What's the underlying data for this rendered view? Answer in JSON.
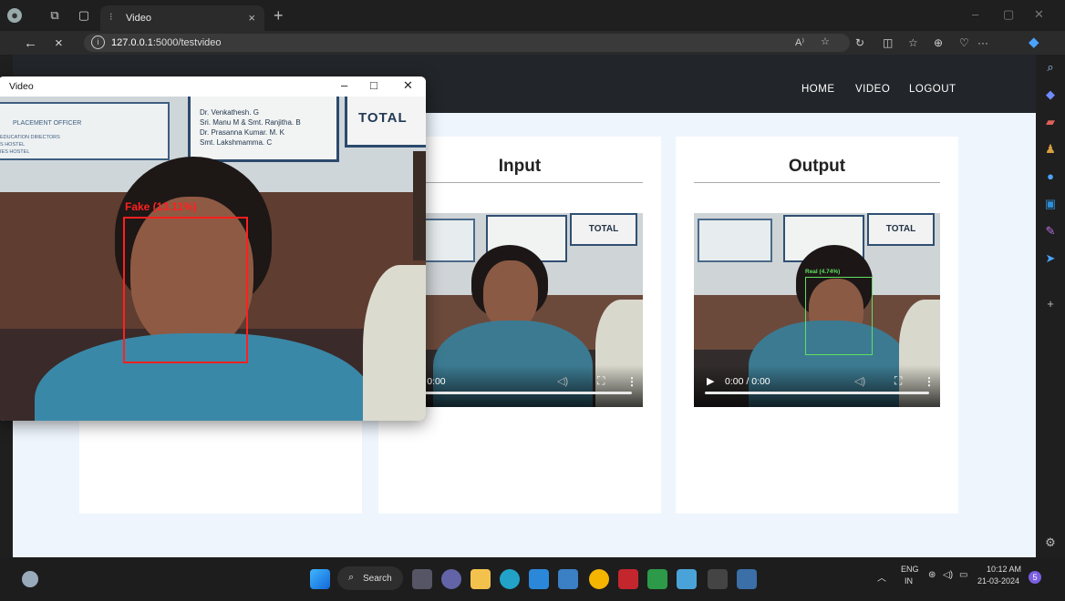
{
  "browser": {
    "tab_title": "Video",
    "tab_close": "×",
    "new_tab": "+",
    "url_host": "127.0.0.1",
    "url_path": ":5000/testvideo",
    "info_icon": "i",
    "back": "←",
    "stop": "×",
    "more": "···"
  },
  "navbar": {
    "links": [
      "HOME",
      "VIDEO",
      "LOGOUT"
    ]
  },
  "cards": {
    "input": {
      "title": "Input",
      "time": "0:00 / 0:00"
    },
    "output": {
      "title": "Output",
      "time": "0:00 / 0:00",
      "detection_label": "Real (4.74%)"
    }
  },
  "cv_window": {
    "title": "Video",
    "minimize": "–",
    "maximize": "□",
    "close": "✕",
    "detection_label": "Fake (13.11%)",
    "board_total": "TOTAL",
    "board_names": [
      "Dr. Venkathesh. G",
      "Sri. Manu M & Smt. Ranjitha. B",
      "Dr. Prasanna Kumar. M. K",
      "Smt. Lakshmamma. C"
    ],
    "board_left": [
      "PLACEMENT OFFICER",
      "EDUCATION DIRECTORS",
      "S HOSTEL",
      "IES HOSTEL"
    ]
  },
  "taskbar": {
    "search_label": "Search",
    "lang_top": "ENG",
    "lang_bottom": "IN",
    "time": "10:12 AM",
    "date": "21-03-2024",
    "notif_count": "5"
  },
  "colors": {
    "fake_box": "#ff2020",
    "real_box": "#5fe05f",
    "navbar_bg": "#222529",
    "page_bg": "#eef5fd"
  }
}
